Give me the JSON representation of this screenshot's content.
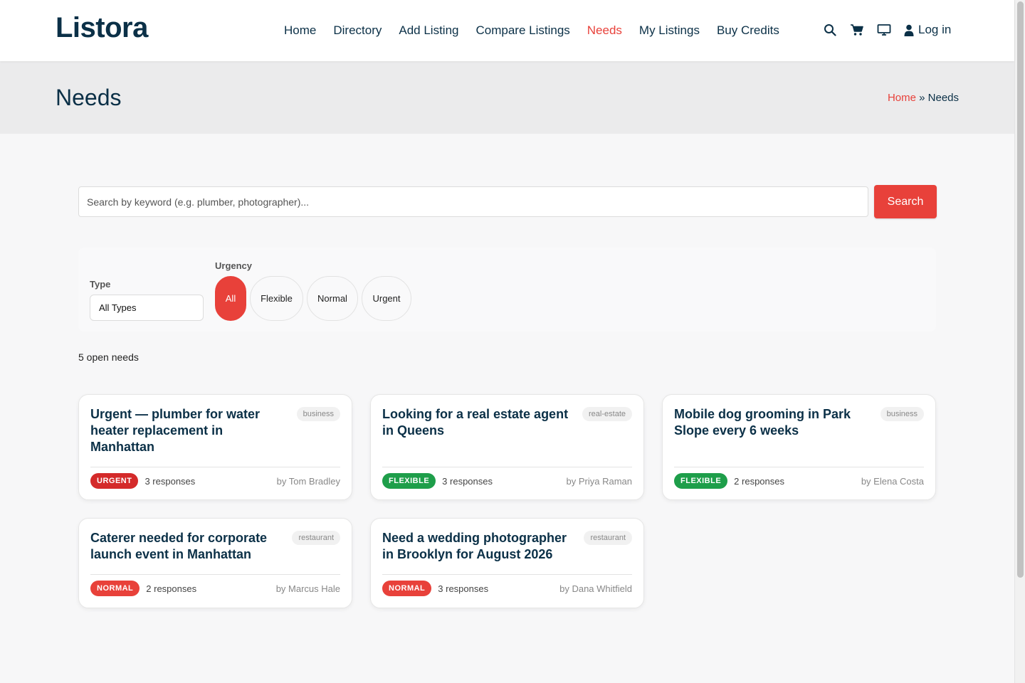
{
  "brand": {
    "name": "Listora"
  },
  "nav": {
    "items": [
      "Home",
      "Directory",
      "Add Listing",
      "Compare Listings",
      "Needs",
      "My Listings",
      "Buy Credits"
    ],
    "active_index": 4,
    "login_label": "Log in",
    "icons": [
      "search-icon",
      "cart-icon",
      "monitor-icon",
      "user-icon"
    ]
  },
  "page": {
    "title": "Needs",
    "breadcrumb": {
      "home": "Home",
      "separator": "»",
      "current": "Needs"
    }
  },
  "search": {
    "placeholder": "Search by keyword (e.g. plumber, photographer)...",
    "value": "",
    "button_label": "Search"
  },
  "filters": {
    "type_label": "Type",
    "type_selected": "All Types",
    "urgency_label": "Urgency",
    "urgency_options": [
      "All",
      "Flexible",
      "Normal",
      "Urgent"
    ],
    "urgency_active": "All"
  },
  "results": {
    "count_text": "5 open needs"
  },
  "cards": [
    {
      "title": "Urgent — plumber for water heater replacement in Manhattan",
      "tag": "business",
      "badge": "URGENT",
      "responses": "3 responses",
      "author": "by Tom Bradley"
    },
    {
      "title": "Looking for a real estate agent in Queens",
      "tag": "real-estate",
      "badge": "FLEXIBLE",
      "responses": "3 responses",
      "author": "by Priya Raman"
    },
    {
      "title": "Mobile dog grooming in Park Slope every 6 weeks",
      "tag": "business",
      "badge": "FLEXIBLE",
      "responses": "2 responses",
      "author": "by Elena Costa"
    },
    {
      "title": "Caterer needed for corporate launch event in Manhattan",
      "tag": "restaurant",
      "badge": "NORMAL",
      "responses": "2 responses",
      "author": "by Marcus Hale"
    },
    {
      "title": "Need a wedding photographer in Brooklyn for August 2026",
      "tag": "restaurant",
      "badge": "NORMAL",
      "responses": "3 responses",
      "author": "by Dana Whitfield"
    }
  ],
  "colors": {
    "accent": "#e8413a",
    "navy": "#0b3047",
    "urgent": "#d42a2a",
    "flexible": "#1e9e4a",
    "normal": "#e8413a"
  }
}
